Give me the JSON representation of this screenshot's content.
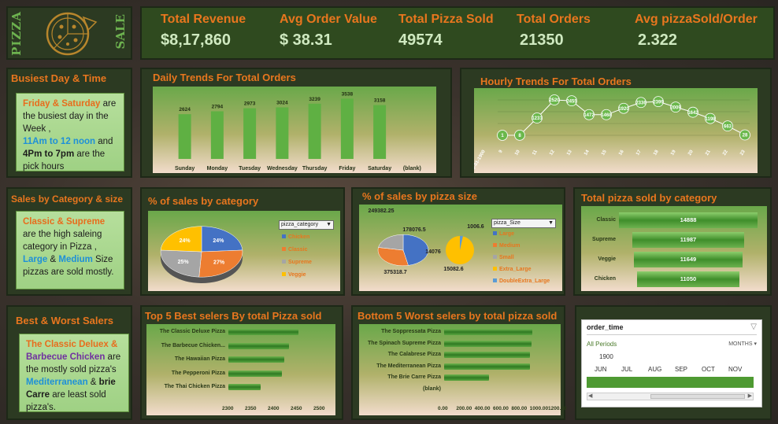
{
  "header": {
    "left_text": "PIZZA",
    "right_text": "SALE",
    "kpis": [
      {
        "label": "Total Revenue",
        "value": "$8,17,860"
      },
      {
        "label": "Avg Order Value",
        "value": "$ 38.31"
      },
      {
        "label": "Total Pizza Sold",
        "value": "49574"
      },
      {
        "label": "Total Orders",
        "value": "21350"
      },
      {
        "label": "Avg pizzaSold/Order",
        "value": "2.322"
      }
    ]
  },
  "insights": {
    "busiest": {
      "title": "Busiest Day & Time",
      "p1_hl": "Friday & Saturday",
      "p1": " are the busiest day in the Week ,",
      "p2_hl": "11Am to 12 noon",
      "p2": "and",
      "p3_hl": "4Pm to 7pm",
      "p3": " are the pick hours"
    },
    "category": {
      "title": "Sales by Category & size",
      "p1_hl": "Classic & Supreme",
      "p1": " are the high saleing category in Pizza ,",
      "p2_hl1": "Large",
      "p2_mid": " & ",
      "p2_hl2": "Medium",
      "p2": " Size pizzas are sold mostly."
    },
    "best": {
      "title": "Best & Worst Salers",
      "hl1": "The Classic Deluex &",
      "hl2": "Barbecue Chicken",
      "p1": " are the mostly sold pizza's",
      "hl3": "Mediterranean",
      "mid": " & ",
      "hl4": "brie Carre",
      "p2": " are least sold pizza's."
    }
  },
  "daily": {
    "title": "Daily Trends For Total Orders",
    "chart_data": {
      "type": "bar",
      "categories": [
        "Sunday",
        "Monday",
        "Tuesday",
        "Wednesday",
        "Thursday",
        "Friday",
        "Saturday",
        "(blank)"
      ],
      "values": [
        2624,
        2794,
        2973,
        3024,
        3239,
        3538,
        3158,
        null
      ]
    }
  },
  "hourly": {
    "title": "Hourly Trends For Total Orders",
    "chart_data": {
      "type": "line",
      "x": [
        "00-01-1900",
        "9",
        "10",
        "11",
        "12",
        "13",
        "14",
        "15",
        "16",
        "17",
        "18",
        "19",
        "20",
        "21",
        "22",
        "23"
      ],
      "values": [
        null,
        1,
        8,
        1231,
        2520,
        2455,
        1472,
        1468,
        1920,
        2336,
        2399,
        2009,
        1642,
        1198,
        663,
        28
      ]
    }
  },
  "pct_category": {
    "title": "% of sales by category",
    "field": "pizza_category",
    "chart_data": {
      "type": "pie",
      "categories": [
        "Chicken",
        "Classic",
        "Supreme",
        "Veggie"
      ],
      "values": [
        24,
        27,
        25,
        24
      ],
      "colors": [
        "#4472c4",
        "#ed7d31",
        "#a5a5a5",
        "#ffc000"
      ]
    }
  },
  "pct_size": {
    "title": "% of sales by pizza size",
    "field": "pizza_Size",
    "chart_data": {
      "type": "pie",
      "categories": [
        "Large",
        "Medium",
        "Small",
        "Extra_Large",
        "DoubleExtra_Large"
      ],
      "values": [
        375318.7,
        249382.25,
        178076.5,
        14076,
        1006.6
      ],
      "labels": [
        "375318.7",
        "249382.25",
        "178076.5",
        "14076",
        "1006.6",
        "15082.6"
      ],
      "colors": [
        "#4472c4",
        "#ed7d31",
        "#a5a5a5",
        "#ffc000",
        "#5b9bd5"
      ]
    }
  },
  "cat_funnel": {
    "title": "Total pizza sold by category",
    "chart_data": {
      "type": "bar",
      "categories": [
        "Classic",
        "Supreme",
        "Veggie",
        "Chicken"
      ],
      "values": [
        14888,
        11987,
        11649,
        11050
      ]
    }
  },
  "top5": {
    "title": "Top 5 Best selers By total Pizza sold",
    "chart_data": {
      "type": "bar",
      "categories": [
        "The Classic Deluxe Pizza",
        "The Barbecue Chicken...",
        "The Hawaiian Pizza",
        "The Pepperoni Pizza",
        "The Thai Chicken Pizza"
      ],
      "values": [
        2453,
        2432,
        2422,
        2418,
        2371
      ],
      "ticks": [
        "2300",
        "2350",
        "2400",
        "2450",
        "2500"
      ],
      "xlim": [
        2300,
        2500
      ]
    }
  },
  "bottom5": {
    "title": "Bottom 5 Worst selers by total pizza sold",
    "chart_data": {
      "type": "bar",
      "categories": [
        "The Soppressata Pizza",
        "The Spinach Supreme Pizza",
        "The Calabrese Pizza",
        "The Mediterranean Pizza",
        "The Brie Carre Pizza",
        "(blank)"
      ],
      "values": [
        961,
        950,
        937,
        934,
        490,
        null
      ],
      "ticks": [
        "0.00",
        "200.00",
        "400.00",
        "600.00",
        "800.00",
        "1000.00",
        "1200.00"
      ],
      "xlim": [
        0,
        1200
      ]
    }
  },
  "timeline": {
    "title": "order_time",
    "periods": "All Periods",
    "unit": "MONTHS",
    "year": "1900",
    "months": [
      "JUN",
      "JUL",
      "AUG",
      "SEP",
      "OCT",
      "NOV"
    ]
  }
}
